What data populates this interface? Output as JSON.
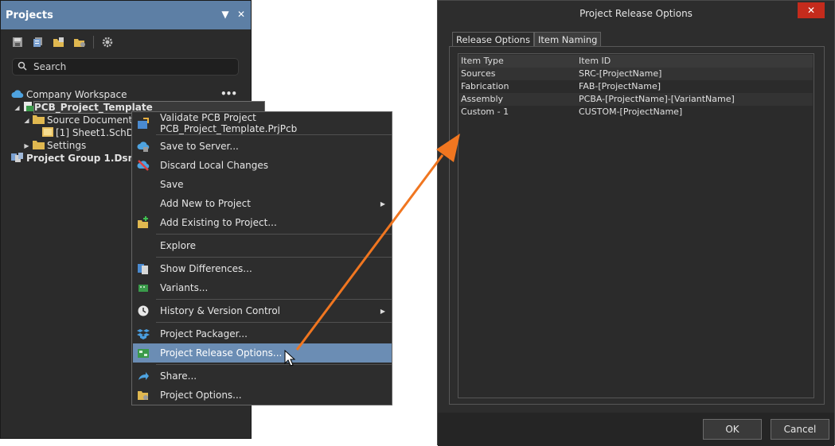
{
  "projects_panel": {
    "title": "Projects",
    "search_placeholder": "Search",
    "tree": {
      "workspace": "Company Workspace",
      "project": "PCB_Project_Template",
      "source_documents": "Source Documents",
      "sheet": "[1] Sheet1.SchDoc",
      "settings": "Settings",
      "project_group": "Project Group 1.DsnWrk"
    }
  },
  "context_menu": {
    "items": [
      {
        "label": "Validate PCB Project PCB_Project_Template.PrjPcb",
        "icon": "validate-icon"
      },
      {
        "label": "Save to Server...",
        "icon": "cloud-save-icon"
      },
      {
        "label": "Discard Local Changes",
        "icon": "discard-icon"
      },
      {
        "label": "Save",
        "icon": ""
      },
      {
        "label": "Add New to Project",
        "icon": "",
        "submenu": true
      },
      {
        "label": "Add Existing to Project...",
        "icon": "add-existing-icon"
      },
      {
        "label": "Explore",
        "icon": ""
      },
      {
        "label": "Show Differences...",
        "icon": "differences-icon"
      },
      {
        "label": "Variants...",
        "icon": "variants-icon"
      },
      {
        "label": "History & Version Control",
        "icon": "history-icon",
        "submenu": true
      },
      {
        "label": "Project Packager...",
        "icon": "packager-icon"
      },
      {
        "label": "Project Release Options...",
        "icon": "release-options-icon",
        "highlighted": true
      },
      {
        "label": "Share...",
        "icon": "share-icon"
      },
      {
        "label": "Project Options...",
        "icon": "project-options-icon"
      }
    ]
  },
  "dialog": {
    "title": "Project Release Options",
    "close_glyph": "✕",
    "tabs": [
      {
        "label": "Release Options",
        "active": false
      },
      {
        "label": "Item Naming",
        "active": true
      }
    ],
    "table": {
      "headers": [
        "Item Type",
        "Item ID"
      ],
      "rows": [
        [
          "Sources",
          "SRC-[ProjectName]"
        ],
        [
          "Fabrication",
          "FAB-[ProjectName]"
        ],
        [
          "Assembly",
          "PCBA-[ProjectName]-[VariantName]"
        ],
        [
          "Custom - 1",
          "CUSTOM-[ProjectName]"
        ]
      ]
    },
    "ok_label": "OK",
    "cancel_label": "Cancel"
  },
  "colors": {
    "panel_header": "#5d7fa5",
    "menu_highlight": "#6b8db4",
    "arrow": "#f07620",
    "close_button": "#c42b1c"
  }
}
